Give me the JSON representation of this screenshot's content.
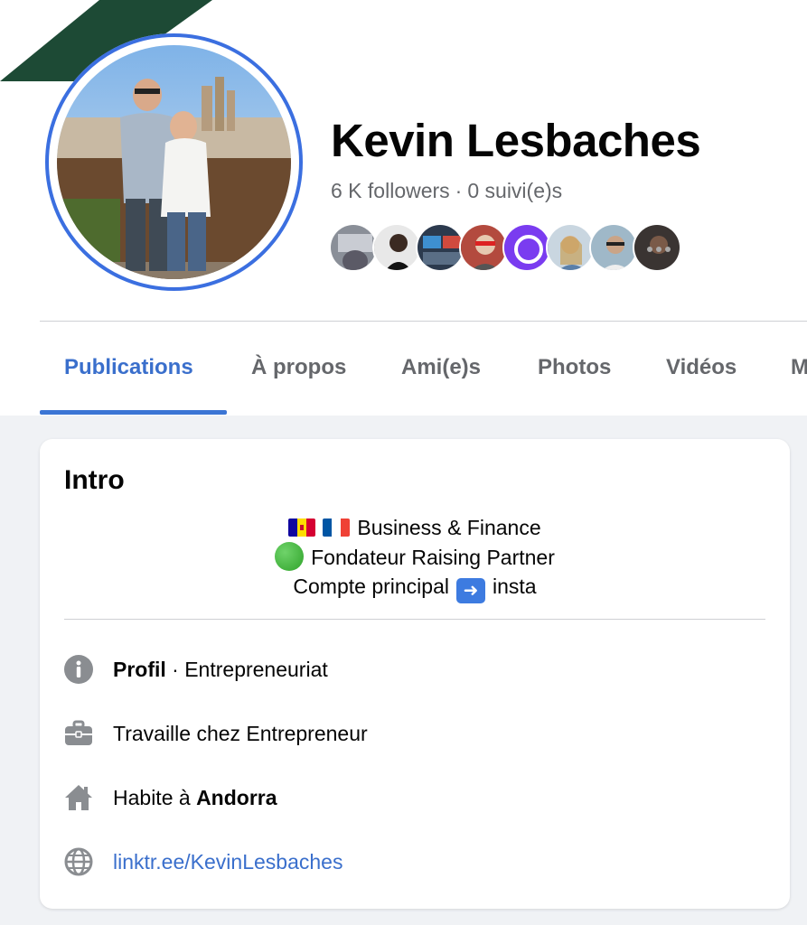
{
  "profile": {
    "name": "Kevin Lesbaches",
    "followers": "6 K followers",
    "separator": "·",
    "following": "0 suivi(e)s"
  },
  "mutual_avatars": [
    "avatar-1",
    "avatar-2",
    "avatar-3",
    "avatar-4",
    "avatar-5",
    "avatar-6",
    "avatar-7",
    "avatar-8"
  ],
  "tabs": [
    {
      "label": "Publications",
      "active": true
    },
    {
      "label": "À propos",
      "active": false
    },
    {
      "label": "Ami(e)s",
      "active": false
    },
    {
      "label": "Photos",
      "active": false
    },
    {
      "label": "Vidéos",
      "active": false
    },
    {
      "label": "M",
      "active": false
    }
  ],
  "intro": {
    "title": "Intro",
    "bio": {
      "line1": "Business & Finance",
      "line2": "Fondateur Raising Partner",
      "line3_before": "Compte principal",
      "line3_after": "insta"
    },
    "details": {
      "profile_label": "Profil",
      "profile_value": "· Entrepreneuriat",
      "work": "Travaille chez Entrepreneur",
      "lives_prefix": "Habite à ",
      "lives_place": "Andorra",
      "link": "linktr.ee/KevinLesbaches"
    }
  },
  "colors": {
    "accent": "#3a6fcc",
    "avatar_ring": "#3b6fe0",
    "cover_stripe": "#1d4a35",
    "muted_text": "#65676b",
    "page_bg": "#f0f2f5"
  }
}
